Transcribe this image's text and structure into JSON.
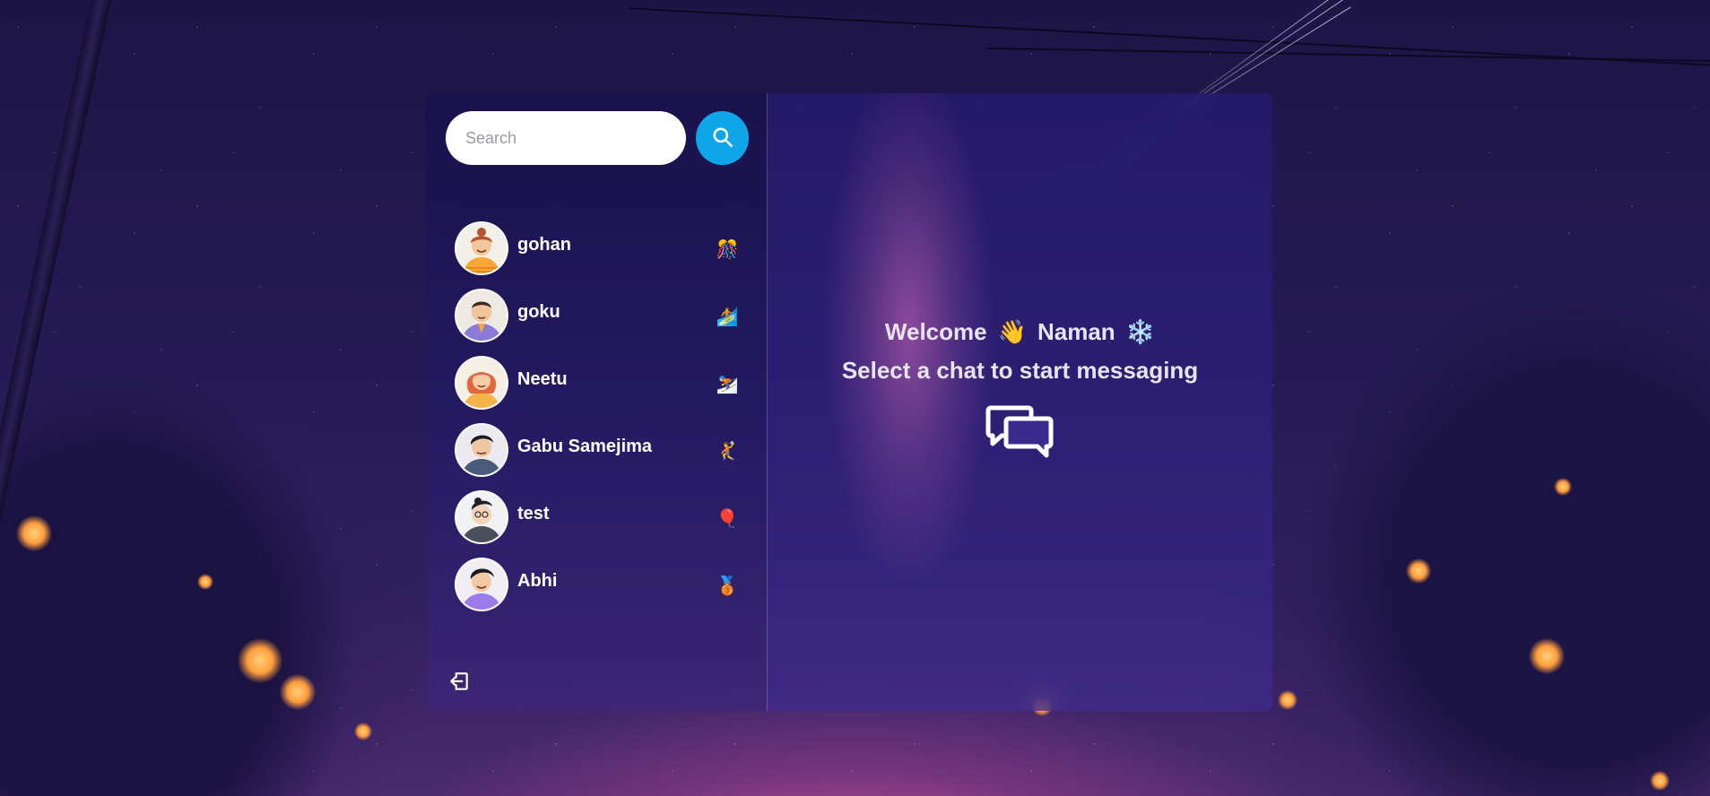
{
  "search": {
    "placeholder": "Search",
    "button_icon": "search-icon"
  },
  "conversations": [
    {
      "name": "gohan",
      "emoji": "🎊",
      "avatar": "avatar-orange-bun"
    },
    {
      "name": "goku",
      "emoji": "🏄",
      "avatar": "avatar-purple-shirt"
    },
    {
      "name": "Neetu",
      "emoji": "⛷️",
      "avatar": "avatar-red-hair"
    },
    {
      "name": "Gabu Samejima",
      "emoji": "🤾",
      "avatar": "avatar-dark-hair"
    },
    {
      "name": "test",
      "emoji": "🎈",
      "avatar": "avatar-glasses"
    },
    {
      "name": "Abhi",
      "emoji": "🥉",
      "avatar": "avatar-lavender-shirt"
    }
  ],
  "sidebar": {
    "logout_icon": "logout-icon"
  },
  "main": {
    "welcome_word": "Welcome",
    "wave_emoji": "👋",
    "user_name": "Naman",
    "snow_emoji": "❄️",
    "subtitle": "Select a chat to start messaging",
    "chat_icon": "chat-bubbles-icon"
  },
  "colors": {
    "accent": "#0ea5e9",
    "text": "#ffffff"
  }
}
